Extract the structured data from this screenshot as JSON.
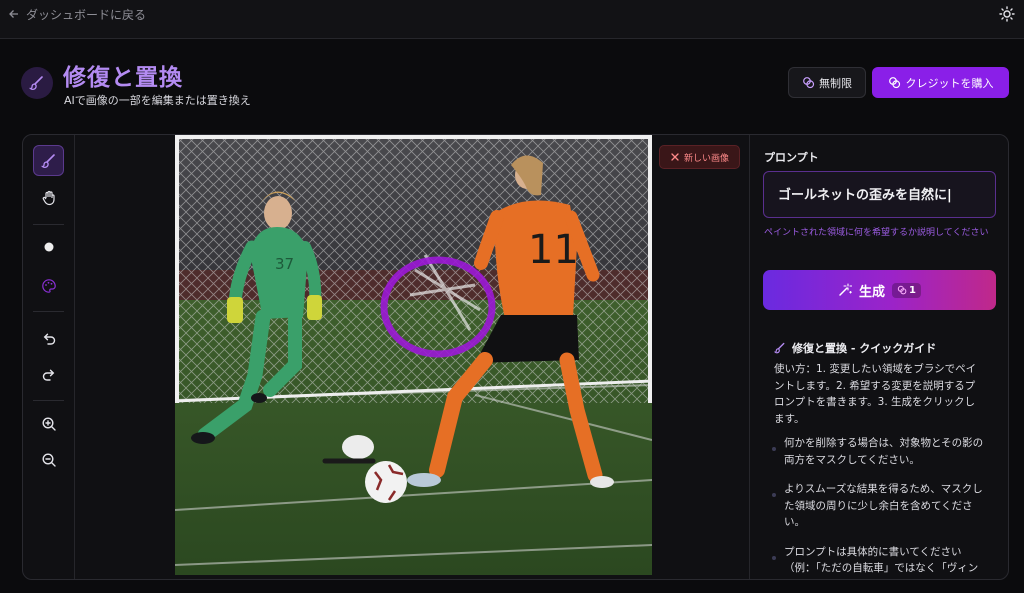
{
  "topbar": {
    "back_label": "ダッシュボードに戻る"
  },
  "header": {
    "title": "修復と置換",
    "subtitle": "AIで画像の一部を編集または置き換え",
    "unlimited_label": "無制限",
    "buy_label": "クレジットを購入"
  },
  "canvas": {
    "new_image_label": "新しい画像"
  },
  "panel": {
    "prompt_label": "プロンプト",
    "prompt_value": "ゴールネットの歪みを自然に",
    "prompt_hint": "ペイントされた領域に何を希望するか説明してください",
    "generate_label": "生成",
    "generate_cost": "1",
    "guide_title": "修復と置換 - クイックガイド",
    "guide_body": "使い方：1. 変更したい領域をブラシでペイントします。2. 希望する変更を説明するプロンプトを書きます。3. 生成をクリックします。",
    "tips": [
      "何かを削除する場合は、対象物とその影の両方をマスクしてください。",
      "よりスムーズな結果を得るため、マスクした領域の周りに少し余白を含めてください。",
      "プロンプトは具体的に書いてください（例：「ただの自転車」ではなく「ヴィンテージの赤い自転車」）。"
    ]
  },
  "player": {
    "jersey_number": "11",
    "keeper_number": "37"
  },
  "colors": {
    "accent": "#8a1fe8",
    "title_purple": "#b48bf2",
    "mask_stroke": "#9b18d6",
    "danger": "#ff8a8a"
  }
}
